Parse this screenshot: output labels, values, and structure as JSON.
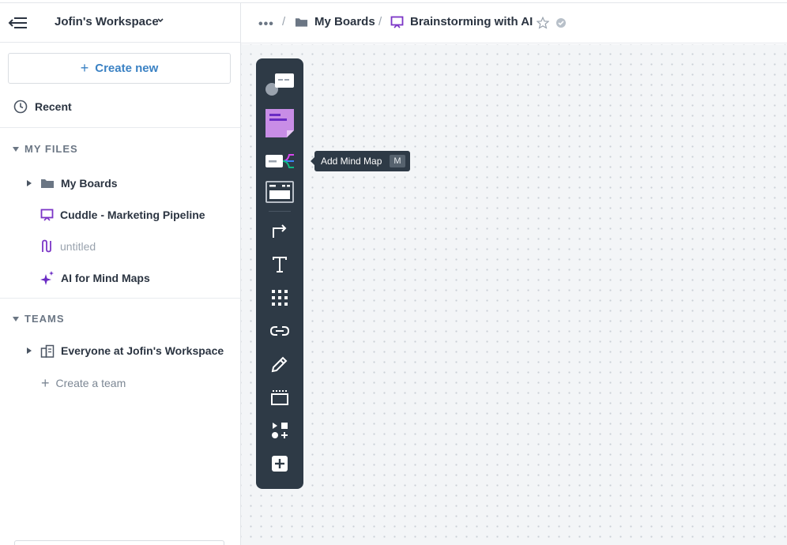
{
  "sidebar": {
    "workspace_title": "Jofin's Workspace",
    "create_label": "Create new",
    "recent_label": "Recent",
    "my_files_label": "MY FILES",
    "files": [
      {
        "label": "My Boards",
        "icon": "folder-icon"
      },
      {
        "label": "Cuddle - Marketing Pipeline",
        "icon": "board-icon"
      },
      {
        "label": "untitled",
        "icon": "flow-icon"
      },
      {
        "label": "AI for Mind Maps",
        "icon": "sparkle-icon"
      }
    ],
    "teams_label": "TEAMS",
    "teams": [
      {
        "label": "Everyone at Jofin's Workspace",
        "icon": "building-icon"
      }
    ],
    "create_team_label": "Create a team"
  },
  "header": {
    "more": "•••",
    "sep": "/",
    "crumb_folder": "My Boards",
    "crumb_board": "Brainstorming with AI"
  },
  "toolbar": {
    "tools": [
      "card-tool",
      "sticky-note-tool",
      "mind-map-tool",
      "template-tool",
      "connector-tool",
      "text-tool",
      "grid-tool",
      "link-tool",
      "pen-tool",
      "frame-tool",
      "shapes-tool",
      "more-tool"
    ],
    "tooltip_label": "Add Mind Map",
    "tooltip_key": "M"
  },
  "colors": {
    "accent": "#3b82c4",
    "board_purple": "#7b35c7",
    "toolbar_bg": "#2e3a46",
    "sticky_purple": "#c88de6"
  }
}
